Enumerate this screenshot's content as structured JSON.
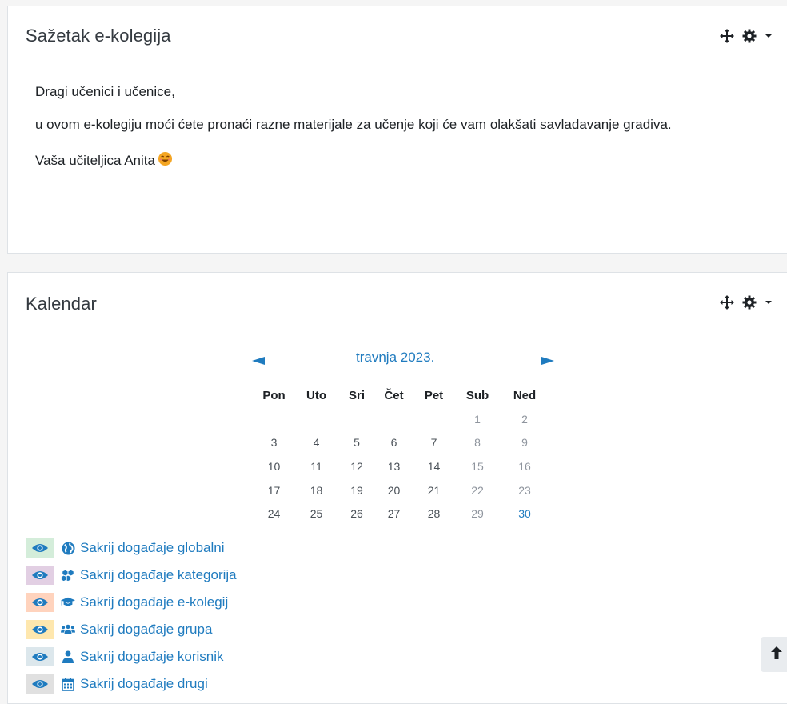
{
  "summary": {
    "title": "Sažetak e-kolegija",
    "paragraphs": [
      "Dragi učenici i učenice,",
      "u ovom e-kolegiju moći ćete pronaći razne materijale za učenje koji će vam olakšati savladavanje gradiva.",
      "Vaša učiteljica Anita"
    ],
    "emoji": "smiling-face-emoji"
  },
  "block_controls": {
    "move_icon": "move-arrows-icon",
    "settings_icon": "gear-icon",
    "menu_icon": "caret-down-icon"
  },
  "calendar": {
    "title": "Kalendar",
    "month_label": "travnja 2023.",
    "prev_icon": "triangle-left-icon",
    "next_icon": "triangle-right-icon",
    "weekdays": [
      "Pon",
      "Uto",
      "Sri",
      "Čet",
      "Pet",
      "Sub",
      "Ned"
    ],
    "weeks": [
      [
        "",
        "",
        "",
        "",
        "",
        "1",
        "2"
      ],
      [
        "3",
        "4",
        "5",
        "6",
        "7",
        "8",
        "9"
      ],
      [
        "10",
        "11",
        "12",
        "13",
        "14",
        "15",
        "16"
      ],
      [
        "17",
        "18",
        "19",
        "20",
        "21",
        "22",
        "23"
      ],
      [
        "24",
        "25",
        "26",
        "27",
        "28",
        "29",
        "30"
      ]
    ],
    "today": "30",
    "filters": [
      {
        "label": "Sakrij događaje globalni",
        "icon": "globe-icon",
        "color": "#d4edda"
      },
      {
        "label": "Sakrij događaje kategorija",
        "icon": "cubes-icon",
        "color": "#e2cfe3"
      },
      {
        "label": "Sakrij događaje e-kolegij",
        "icon": "graduation-cap-icon",
        "color": "#ffd3bd"
      },
      {
        "label": "Sakrij događaje grupa",
        "icon": "users-icon",
        "color": "#fee7ae"
      },
      {
        "label": "Sakrij događaje korisnik",
        "icon": "user-icon",
        "color": "#dce7ec"
      },
      {
        "label": "Sakrij događaje drugi",
        "icon": "calendar-icon",
        "color": "#e0e0e0"
      }
    ]
  },
  "back_to_top_icon": "arrow-up-icon",
  "colors": {
    "link": "#1f7bbf",
    "text": "#1d2125",
    "muted": "#8f959e",
    "eye_icon": "#1f7bbf"
  }
}
